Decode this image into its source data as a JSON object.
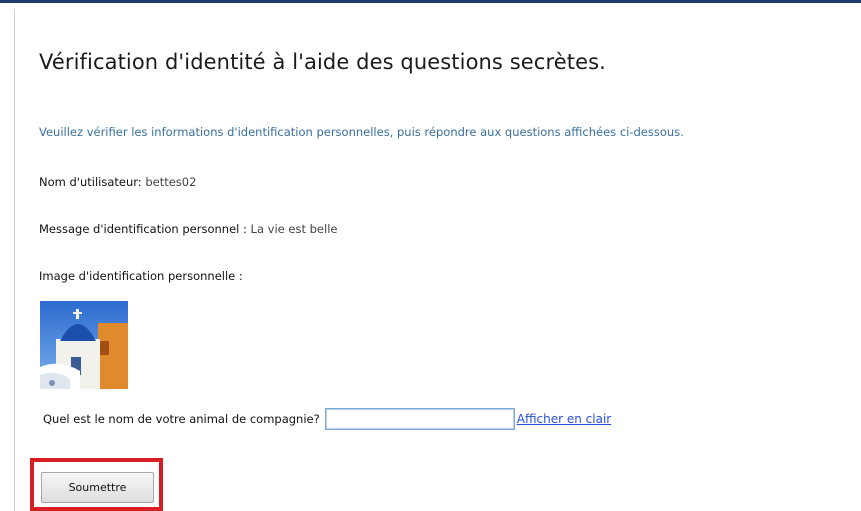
{
  "page": {
    "title": "Vérification d'identité à l'aide des questions secrètes.",
    "instructions": "Veuillez vérifier les informations d'identification personnelles, puis répondre aux questions affichées ci-dessous."
  },
  "identity": {
    "username_label": "Nom d'utilisateur:",
    "username_value": "bettes02",
    "message_label": "Message d'identification personnel :",
    "message_value": "La vie est belle",
    "image_label": "Image d'identification personnelle :"
  },
  "security_question": {
    "question": "Quel est le nom de votre animal de compagnie?",
    "answer_value": "",
    "show_link": "Afficher en clair"
  },
  "actions": {
    "submit_label": "Soumettre"
  },
  "colors": {
    "instructions_text": "#3a6fa0",
    "link": "#2a4fd8",
    "highlight_box": "#d81e23"
  }
}
